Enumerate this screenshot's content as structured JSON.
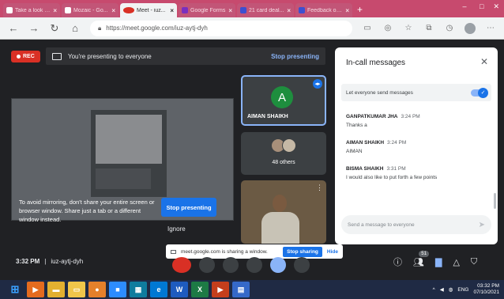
{
  "browser": {
    "tabs": [
      {
        "title": "Take a look at...",
        "active": false
      },
      {
        "title": "Mozaic - Go...",
        "active": false
      },
      {
        "title": "Meet - iuz...",
        "active": true
      },
      {
        "title": "Google Forms",
        "active": false
      },
      {
        "title": "21 card deal...",
        "active": false
      },
      {
        "title": "Feedback on...",
        "active": false
      }
    ],
    "url": "https://meet.google.com/iuz-aytj-dyh"
  },
  "meet": {
    "rec_label": "REC",
    "presenting_text": "You're presenting to everyone",
    "stop_presenting": "Stop presenting",
    "mirror_warning": "To avoid mirroring, don't share your entire screen or browser window. Share just a tab or a different window instead.",
    "mirror_stop": "Stop presenting",
    "ignore": "Ignore",
    "tiles": {
      "aiman_initial": "A",
      "aiman_name": "AIMAN SHAIKH",
      "others_count": "48 others"
    },
    "share_bar": {
      "text": "meet.google.com is sharing a window.",
      "stop": "Stop sharing",
      "hide": "Hide"
    },
    "time": "3:32 PM",
    "separator": "|",
    "meeting_code": "iuz-aytj-dyh",
    "participants_badge": "51"
  },
  "chat": {
    "title": "In-call messages",
    "let_everyone": "Let everyone send messages",
    "messages": [
      {
        "sender": "GANPATKUMAR JHA",
        "time": "3:24 PM",
        "text": "Thanks a"
      },
      {
        "sender": "AIMAN SHAIKH",
        "time": "3:24 PM",
        "text": "AIMAN"
      },
      {
        "sender": "BISMA SHAIKH",
        "time": "3:31 PM",
        "text": "I would also like to put forth a few points"
      }
    ],
    "placeholder": "Send a message to everyone"
  },
  "taskbar": {
    "apps": [
      "W",
      "X"
    ],
    "lang": "ENG",
    "clock_time": "03:32 PM",
    "clock_date": "07/10/2021"
  }
}
